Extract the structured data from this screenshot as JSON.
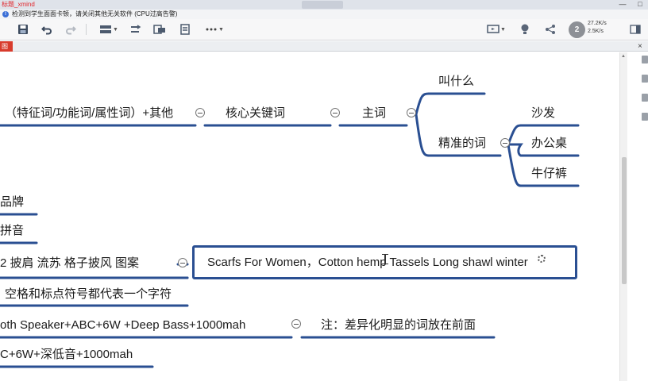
{
  "window": {
    "title": "标题_xmind",
    "watermark": " ",
    "buttons": [
      "—",
      "□"
    ]
  },
  "notification": {
    "text": "检测到学生面面卡顿，请关闭其他无关软件 (CPU过高告警)"
  },
  "toolbar": {
    "zoom_line1": "27.2K/s",
    "zoom_line2": "2.5K/s",
    "zoom_badge": "2"
  },
  "tabs": [
    {
      "label": "图"
    }
  ],
  "tab_close": "×",
  "mindmap": {
    "nodes": {
      "attr_words": "（特征词/功能词/属性词）+其他",
      "core_keyword": "核心关键词",
      "main_word": "主词",
      "what_called": "叫什么",
      "precise_word": "精准的词",
      "sofa": "沙发",
      "office_desk": "办公桌",
      "jeans": "牛仔裤",
      "brand": "品牌",
      "pinyin": "拼音",
      "scarf_cn": "2  披肩  流苏    格子披风  图案",
      "scarf_en": "Scarfs For Women，Cotton hemp Tassels  Long shawl winter",
      "space_rule": "空格和标点符号都代表一个字符",
      "speaker_en": "oth   Speaker+ABC+6W +Deep  Bass+1000mah",
      "note": "注：差异化明显的词放在前面",
      "speaker_cn": "C+6W+深低音+1000mah"
    }
  }
}
